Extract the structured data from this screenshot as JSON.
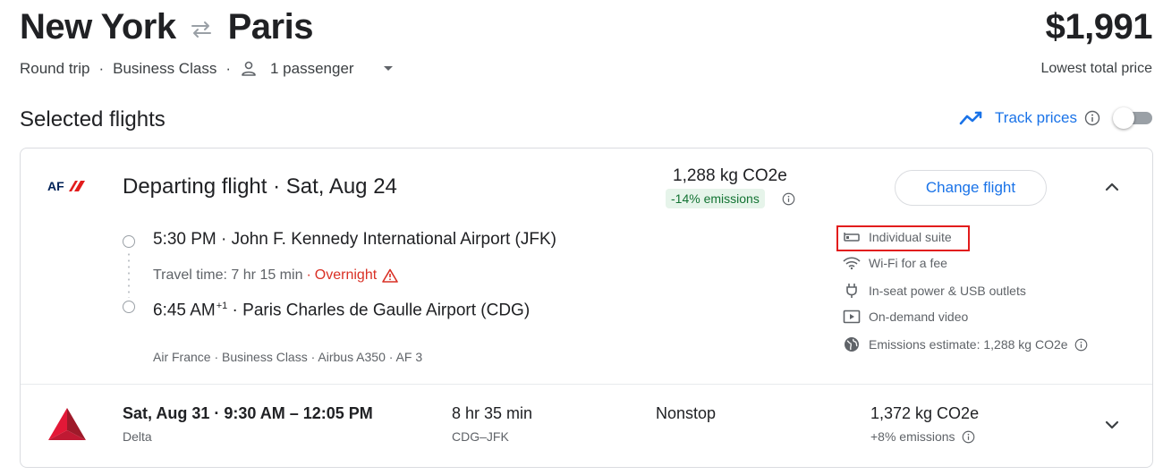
{
  "header": {
    "origin": "New York",
    "destination": "Paris",
    "price": "$1,991",
    "trip_type": "Round trip",
    "cabin": "Business Class",
    "passengers": "1 passenger",
    "price_caption": "Lowest total price"
  },
  "section": {
    "title": "Selected flights",
    "track_label": "Track prices",
    "track_enabled": false
  },
  "departing": {
    "title": "Departing flight",
    "date": "Sat, Aug 24",
    "co2": "1,288 kg CO2e",
    "emissions_badge": "-14% emissions",
    "change_button": "Change flight",
    "dep_time": "5:30 PM",
    "dep_airport": "John F. Kennedy International Airport (JFK)",
    "travel_time": "Travel time: 7 hr 15 min",
    "overnight": "Overnight",
    "arr_time": "6:45 AM",
    "arr_day_offset": "+1",
    "arr_airport": "Paris Charles de Gaulle Airport (CDG)",
    "details": "Air France · Business Class · Airbus A350 · AF 3",
    "amenities": [
      {
        "label": "Individual suite",
        "icon": "seat-icon"
      },
      {
        "label": "Wi-Fi for a fee",
        "icon": "wifi-icon"
      },
      {
        "label": "In-seat power & USB outlets",
        "icon": "power-plug-icon"
      },
      {
        "label": "On-demand video",
        "icon": "video-icon"
      },
      {
        "label": "Emissions estimate: 1,288 kg CO2e",
        "icon": "globe-icon"
      }
    ]
  },
  "returning": {
    "date": "Sat, Aug 31",
    "times": "9:30 AM – 12:05 PM",
    "airline": "Delta",
    "duration": "8 hr 35 min",
    "route": "CDG–JFK",
    "stops": "Nonstop",
    "co2": "1,372 kg CO2e",
    "emissions": "+8% emissions"
  },
  "colors": {
    "accent": "#1a73e8",
    "emissions_good_bg": "#e6f4ea",
    "emissions_good_text": "#137333",
    "warning": "#d93025",
    "highlight_box": "#e21c1c"
  }
}
